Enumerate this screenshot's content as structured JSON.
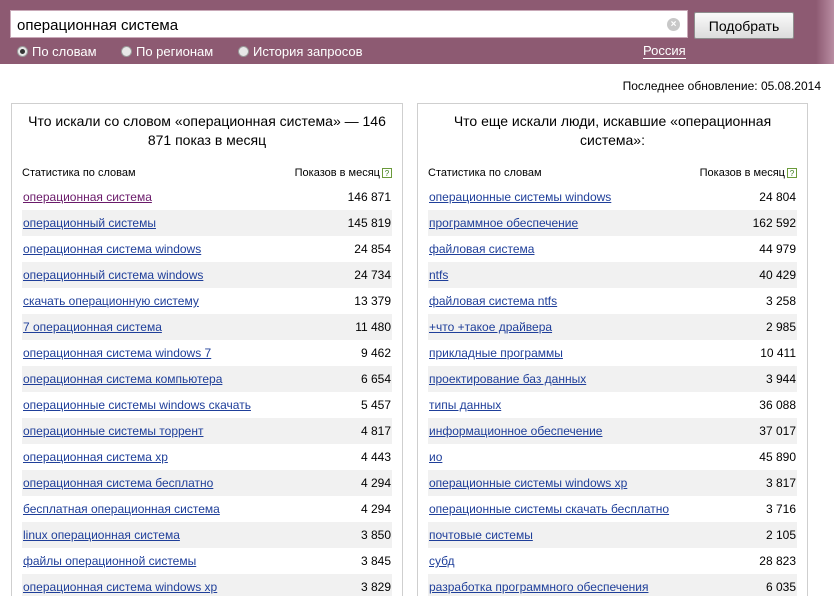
{
  "search": {
    "query": "операционная система",
    "submit_label": "Подобрать"
  },
  "modes": [
    {
      "label": "По словам",
      "checked": true
    },
    {
      "label": "По регионам",
      "checked": false
    },
    {
      "label": "История запросов",
      "checked": false
    }
  ],
  "region": "Россия",
  "updated": "Последнее обновление: 05.08.2014",
  "left_panel": {
    "title": "Что искали со словом «операционная система» — 146 871 показ в месяц",
    "col_keyword": "Статистика по словам",
    "col_count": "Показов в месяц",
    "help_icon": "?",
    "rows": [
      {
        "keyword": "операционная система",
        "count": "146 871"
      },
      {
        "keyword": "операционный системы",
        "count": "145 819"
      },
      {
        "keyword": "операционная система windows",
        "count": "24 854"
      },
      {
        "keyword": "операционный система windows",
        "count": "24 734"
      },
      {
        "keyword": "скачать операционную систему",
        "count": "13 379"
      },
      {
        "keyword": "7 операционная система",
        "count": "11 480"
      },
      {
        "keyword": "операционная система windows 7",
        "count": "9 462"
      },
      {
        "keyword": "операционная система компьютера",
        "count": "6 654"
      },
      {
        "keyword": "операционные системы windows скачать",
        "count": "5 457"
      },
      {
        "keyword": "операционные системы торрент",
        "count": "4 817"
      },
      {
        "keyword": "операционная система xp",
        "count": "4 443"
      },
      {
        "keyword": "операционная система бесплатно",
        "count": "4 294"
      },
      {
        "keyword": "бесплатная операционная система",
        "count": "4 294"
      },
      {
        "keyword": "linux операционная система",
        "count": "3 850"
      },
      {
        "keyword": "файлы операционной системы",
        "count": "3 845"
      },
      {
        "keyword": "операционная система windows xp",
        "count": "3 829"
      }
    ]
  },
  "right_panel": {
    "title": "Что еще искали люди, искавшие «операционная система»:",
    "col_keyword": "Статистика по словам",
    "col_count": "Показов в месяц",
    "help_icon": "?",
    "rows": [
      {
        "keyword": "операционные системы windows",
        "count": "24 804"
      },
      {
        "keyword": "программное обеспечение",
        "count": "162 592"
      },
      {
        "keyword": "файловая система",
        "count": "44 979"
      },
      {
        "keyword": "ntfs",
        "count": "40 429"
      },
      {
        "keyword": "файловая система ntfs",
        "count": "3 258"
      },
      {
        "keyword": "+что +такое драйвера",
        "count": "2 985"
      },
      {
        "keyword": "прикладные программы",
        "count": "10 411"
      },
      {
        "keyword": "проектирование баз данных",
        "count": "3 944"
      },
      {
        "keyword": "типы данных",
        "count": "36 088"
      },
      {
        "keyword": "информационное обеспечение",
        "count": "37 017"
      },
      {
        "keyword": "ио",
        "count": "45 890"
      },
      {
        "keyword": "операционные системы windows xp",
        "count": "3 817"
      },
      {
        "keyword": "операционные системы скачать бесплатно",
        "count": "3 716"
      },
      {
        "keyword": "почтовые системы",
        "count": "2 105"
      },
      {
        "keyword": "субд",
        "count": "28 823"
      },
      {
        "keyword": "разработка программного обеспечения",
        "count": "6 035"
      }
    ]
  }
}
